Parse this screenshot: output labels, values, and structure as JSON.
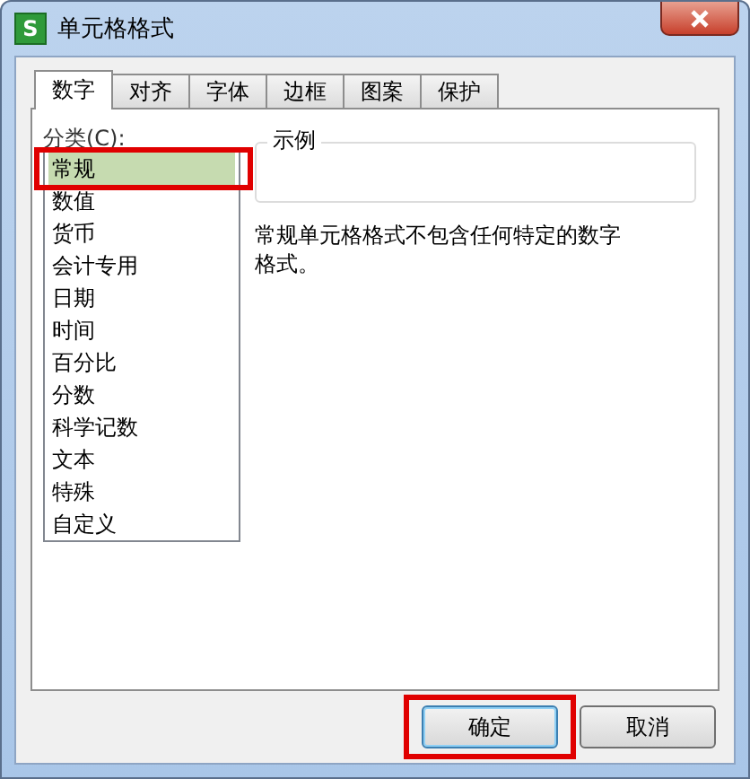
{
  "window": {
    "logo": "S",
    "title": "单元格格式"
  },
  "tabs": [
    {
      "label": "数字",
      "selected": true
    },
    {
      "label": "对齐",
      "selected": false
    },
    {
      "label": "字体",
      "selected": false
    },
    {
      "label": "边框",
      "selected": false
    },
    {
      "label": "图案",
      "selected": false
    },
    {
      "label": "保护",
      "selected": false
    }
  ],
  "category_label": "分类(C):",
  "categories": [
    {
      "label": "常规",
      "selected": true,
      "highlighted": true
    },
    {
      "label": "数值",
      "selected": false,
      "highlighted": false
    },
    {
      "label": "货币",
      "selected": false,
      "highlighted": false
    },
    {
      "label": "会计专用",
      "selected": false,
      "highlighted": false
    },
    {
      "label": "日期",
      "selected": false,
      "highlighted": false
    },
    {
      "label": "时间",
      "selected": false,
      "highlighted": false
    },
    {
      "label": "百分比",
      "selected": false,
      "highlighted": false
    },
    {
      "label": "分数",
      "selected": false,
      "highlighted": false
    },
    {
      "label": "科学记数",
      "selected": false,
      "highlighted": false
    },
    {
      "label": "文本",
      "selected": false,
      "highlighted": false
    },
    {
      "label": "特殊",
      "selected": false,
      "highlighted": false
    },
    {
      "label": "自定义",
      "selected": false,
      "highlighted": false
    }
  ],
  "sample": {
    "label": "示例"
  },
  "description": "常规单元格格式不包含任何特定的数字格式。",
  "buttons": [
    {
      "label": "确定",
      "default": true,
      "highlighted": true
    },
    {
      "label": "取消",
      "default": false,
      "highlighted": false
    }
  ]
}
